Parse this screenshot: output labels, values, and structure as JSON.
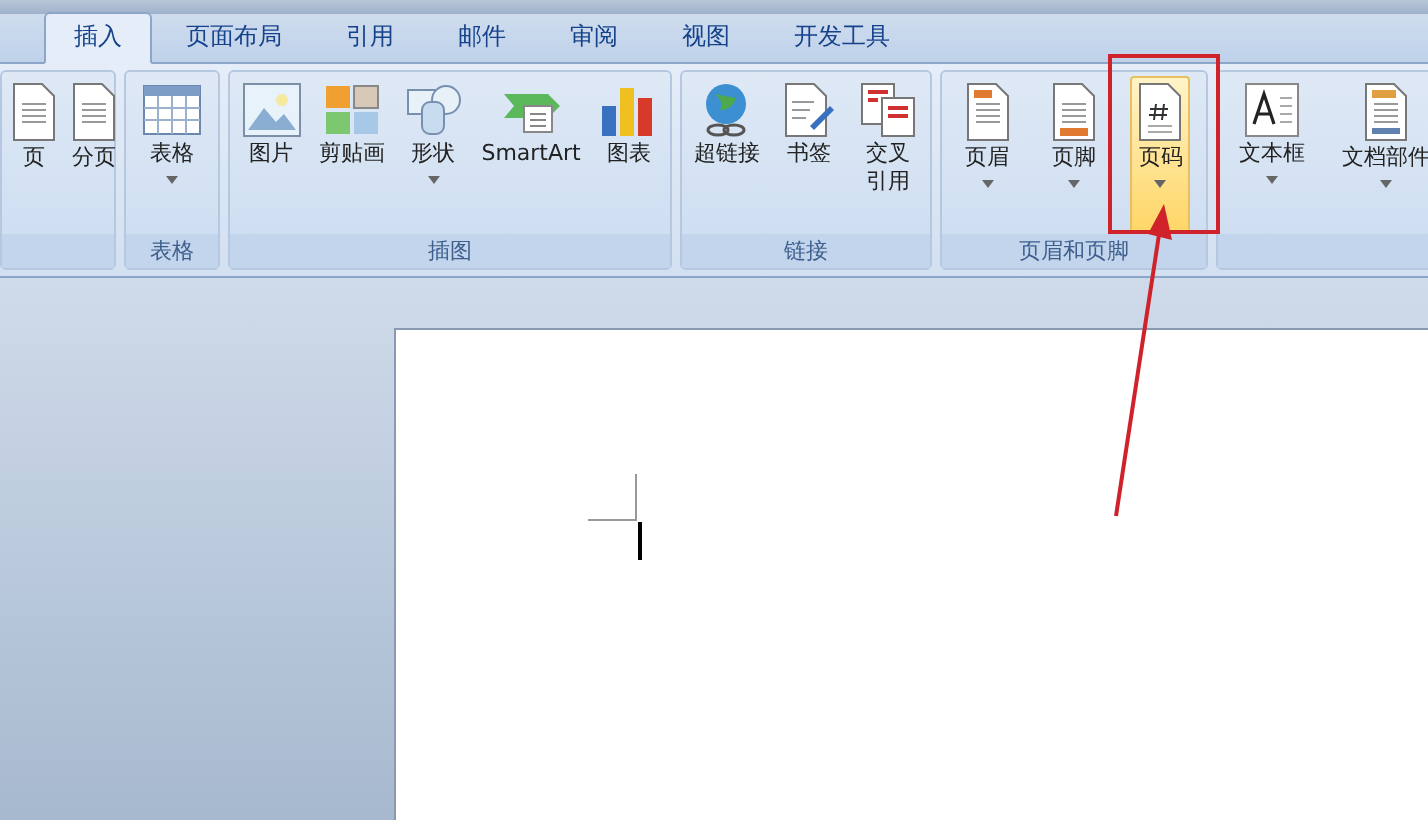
{
  "tabs": [
    {
      "label": "插入",
      "selected": true
    },
    {
      "label": "页面布局",
      "selected": false
    },
    {
      "label": "引用",
      "selected": false
    },
    {
      "label": "邮件",
      "selected": false
    },
    {
      "label": "审阅",
      "selected": false
    },
    {
      "label": "视图",
      "selected": false
    },
    {
      "label": "开发工具",
      "selected": false
    }
  ],
  "ribbon_groups": [
    {
      "items": [
        {
          "label": "页",
          "dropdown": false,
          "selected": false
        },
        {
          "label": "分页",
          "dropdown": false,
          "selected": false
        }
      ]
    },
    {
      "label": "表格",
      "items": [
        {
          "label": "表格",
          "dropdown": true,
          "selected": false
        }
      ]
    },
    {
      "label": "插图",
      "items": [
        {
          "label": "图片",
          "dropdown": false,
          "selected": false
        },
        {
          "label": "剪贴画",
          "dropdown": false,
          "selected": false
        },
        {
          "label": "形状",
          "dropdown": true,
          "selected": false
        },
        {
          "label": "SmartArt",
          "dropdown": false,
          "selected": false
        },
        {
          "label": "图表",
          "dropdown": false,
          "selected": false
        }
      ]
    },
    {
      "label": "链接",
      "items": [
        {
          "label": "超链接",
          "dropdown": false,
          "selected": false
        },
        {
          "label": "书签",
          "dropdown": false,
          "selected": false
        },
        {
          "label": "交叉",
          "label_2": "引用",
          "dropdown": false,
          "selected": false
        }
      ]
    },
    {
      "label": "页眉和页脚",
      "items": [
        {
          "label": "页眉",
          "dropdown": true,
          "selected": false
        },
        {
          "label": "页脚",
          "dropdown": true,
          "selected": false
        },
        {
          "label": "页码",
          "dropdown": true,
          "selected": true
        }
      ]
    },
    {
      "items": [
        {
          "label": "文本框",
          "dropdown": true,
          "selected": false
        },
        {
          "label": "文档部件",
          "dropdown": true,
          "selected": false
        }
      ]
    }
  ]
}
